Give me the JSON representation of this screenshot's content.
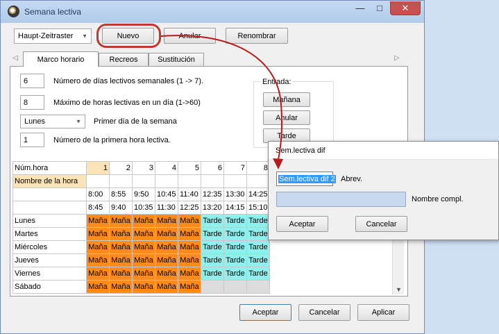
{
  "window": {
    "title": "Semana lectiva",
    "minimize": "—",
    "maximize": "□",
    "close": "✕"
  },
  "toolbar": {
    "raster_value": "Haupt-Zeitraster",
    "new_label": "Nuevo",
    "cancel_label": "Anular",
    "rename_label": "Renombrar"
  },
  "tabs": [
    "Marco horario",
    "Recreos",
    "Sustitución"
  ],
  "tab_nav": {
    "left": "◁",
    "right": "▷"
  },
  "settings": {
    "days_value": "6",
    "days_label": "Número de días lectivos semanales (1 -> 7).",
    "hours_value": "8",
    "hours_label": "Máximo de horas lectivas en un día (1->60)",
    "first_day_value": "Lunes",
    "first_day_label": "Primer día de la semana",
    "first_hour_value": "1",
    "first_hour_label": "Número de la primera hora lectiva."
  },
  "entry": {
    "group_label": "Entrada:",
    "morning_button": "Mañana",
    "cancel_button": "Anular",
    "afternoon_button": "Tarde"
  },
  "grid": {
    "hour_label": "Núm.hora",
    "name_label": "Nombre de la hora",
    "hours": [
      "1",
      "2",
      "3",
      "4",
      "5",
      "6",
      "7",
      "8"
    ],
    "start_times": [
      "8:00",
      "8:55",
      "9:50",
      "10:45",
      "11:40",
      "12:35",
      "13:30",
      "14:25"
    ],
    "end_times": [
      "8:45",
      "9:40",
      "10:35",
      "11:30",
      "12:25",
      "13:20",
      "14:15",
      "15:10"
    ],
    "morning": "Maña",
    "afternoon": "Tarde",
    "days": [
      {
        "name": "Lunes",
        "cells": [
          "m",
          "m",
          "m",
          "m",
          "m",
          "t",
          "t",
          "t"
        ]
      },
      {
        "name": "Martes",
        "cells": [
          "m",
          "m",
          "m",
          "m",
          "m",
          "t",
          "t",
          "t"
        ]
      },
      {
        "name": "Miércoles",
        "cells": [
          "m",
          "m",
          "m",
          "m",
          "m",
          "t",
          "t",
          "t"
        ]
      },
      {
        "name": "Jueves",
        "cells": [
          "m",
          "m",
          "m",
          "m",
          "m",
          "t",
          "t",
          "t"
        ]
      },
      {
        "name": "Viernes",
        "cells": [
          "m",
          "m",
          "m",
          "m",
          "m",
          "t",
          "t",
          "t"
        ]
      },
      {
        "name": "Sábado",
        "cells": [
          "m",
          "m",
          "m",
          "m",
          "m",
          "e",
          "e",
          "e"
        ]
      }
    ]
  },
  "footer": {
    "accept": "Aceptar",
    "cancel": "Cancelar",
    "apply": "Aplicar"
  },
  "dialog": {
    "title": "Sem.lectiva dif",
    "short_value": "Sem.lectiva dif 2",
    "short_label": "Abrev.",
    "full_value": "",
    "full_label": "Nombre compl.",
    "accept": "Aceptar",
    "cancel": "Cancelar"
  },
  "colors": {
    "morning": "#ff8c1a",
    "afternoon": "#8ff0ee",
    "highlight_ring": "#c0392b",
    "arrow": "#b71c1c",
    "title_bar": "#b8d0ed"
  }
}
